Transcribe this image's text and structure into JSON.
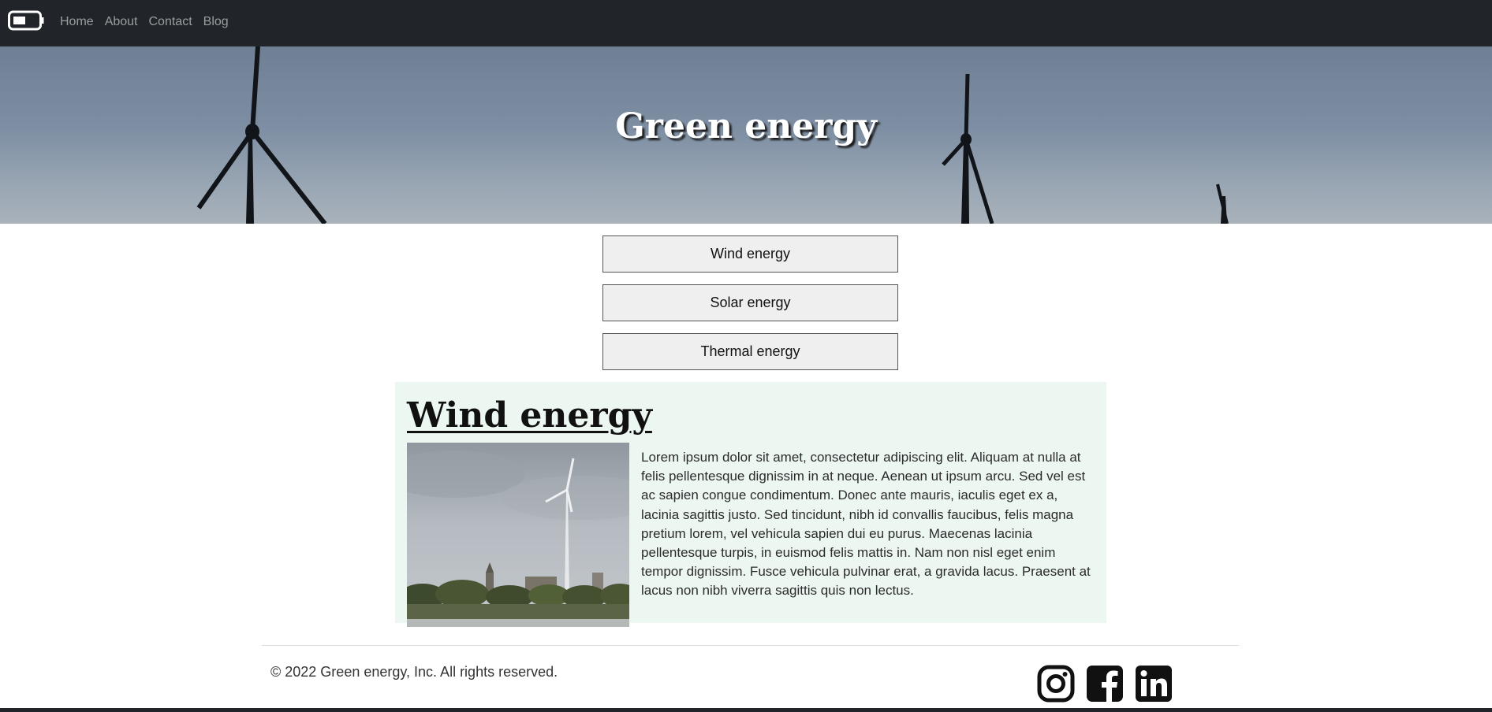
{
  "nav": {
    "logo_icon": "battery-icon",
    "links": [
      "Home",
      "About",
      "Contact",
      "Blog"
    ]
  },
  "hero": {
    "title": "Green energy"
  },
  "energy_buttons": [
    "Wind energy",
    "Solar energy",
    "Thermal energy"
  ],
  "section": {
    "title": "Wind energy",
    "image_icon": "wind-turbine-photo",
    "body": "Lorem ipsum dolor sit amet, consectetur adipiscing elit. Aliquam at nulla at felis pellentesque dignissim in at neque. Aenean ut ipsum arcu. Sed vel est ac sapien congue condimentum. Donec ante mauris, iaculis eget ex a, lacinia sagittis justo. Sed tincidunt, nibh id convallis faucibus, felis magna pretium lorem, vel vehicula sapien dui eu purus. Maecenas lacinia pellentesque turpis, in euismod felis mattis in. Nam non nisl eget enim tempor dignissim. Fusce vehicula pulvinar erat, a gravida lacus. Praesent at lacus non nibh viverra sagittis quis non lectus."
  },
  "footer": {
    "copyright": "© 2022 Green energy, Inc. All rights reserved.",
    "social_icons": [
      "instagram-icon",
      "facebook-icon",
      "linkedin-icon"
    ]
  },
  "colors": {
    "navbar": "#212529",
    "nav_link": "#9a9da0",
    "card_background": "#edf7f2",
    "button_background": "#efefef"
  }
}
